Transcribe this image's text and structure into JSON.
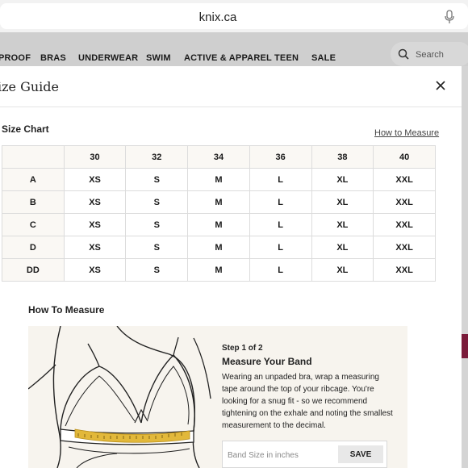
{
  "browser": {
    "url": "knix.ca",
    "mic_icon": "mic-icon"
  },
  "nav": {
    "items": [
      "PROOF",
      "BRAS",
      "UNDERWEAR",
      "SWIM",
      "ACTIVE & APPAREL",
      "TEEN",
      "SALE"
    ],
    "search_placeholder": "Search"
  },
  "modal": {
    "title": "Size Guide",
    "chart_heading": "Size Chart",
    "how_to_measure_link": "How to Measure",
    "table": {
      "columns": [
        "30",
        "32",
        "34",
        "36",
        "38",
        "40"
      ],
      "rows": [
        {
          "cup": "A",
          "sizes": [
            "XS",
            "S",
            "M",
            "L",
            "XL",
            "XXL"
          ]
        },
        {
          "cup": "B",
          "sizes": [
            "XS",
            "S",
            "M",
            "L",
            "XL",
            "XXL"
          ]
        },
        {
          "cup": "C",
          "sizes": [
            "XS",
            "S",
            "M",
            "L",
            "XL",
            "XXL"
          ]
        },
        {
          "cup": "D",
          "sizes": [
            "XS",
            "S",
            "M",
            "L",
            "XL",
            "XXL"
          ]
        },
        {
          "cup": "DD",
          "sizes": [
            "XS",
            "S",
            "M",
            "L",
            "XL",
            "XXL"
          ]
        }
      ]
    },
    "measure": {
      "heading": "How To Measure",
      "step_label": "Step 1 of 2",
      "step_title": "Measure Your Band",
      "description": "Wearing an unpaded bra, wrap a measuring tape around the top of your ribcage. You're looking for a snug fit - so we recommend tightening on the exhale and noting the smallest measurement to the decimal.",
      "input_placeholder": "Band Size in inches",
      "save_label": "SAVE"
    }
  },
  "colors": {
    "accent_behind": "#7a1b3a",
    "tape": "#e2b83a",
    "panel_bg": "#f7f4ee"
  }
}
